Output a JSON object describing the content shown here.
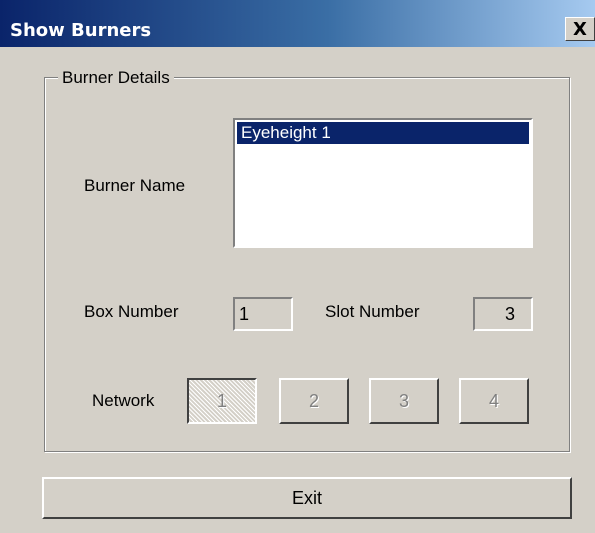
{
  "window": {
    "title": "Show Burners",
    "close_icon": "close-icon",
    "close_glyph": "X"
  },
  "burner_details": {
    "group_label": "Burner Details",
    "burner_name_label": "Burner Name",
    "burner_names": [
      "Eyeheight 1"
    ],
    "selected_burner": "Eyeheight 1",
    "box_number_label": "Box Number",
    "box_number_value": "1",
    "slot_number_label": "Slot Number",
    "slot_number_value": "3",
    "network_label": "Network",
    "network_buttons": [
      "1",
      "2",
      "3",
      "4"
    ],
    "network_selected": "1"
  },
  "exit_label": "Exit",
  "colors": {
    "face": "#d4d0c8",
    "selection": "#0a246a",
    "title_start": "#0a246a",
    "title_end": "#a6caf0"
  }
}
